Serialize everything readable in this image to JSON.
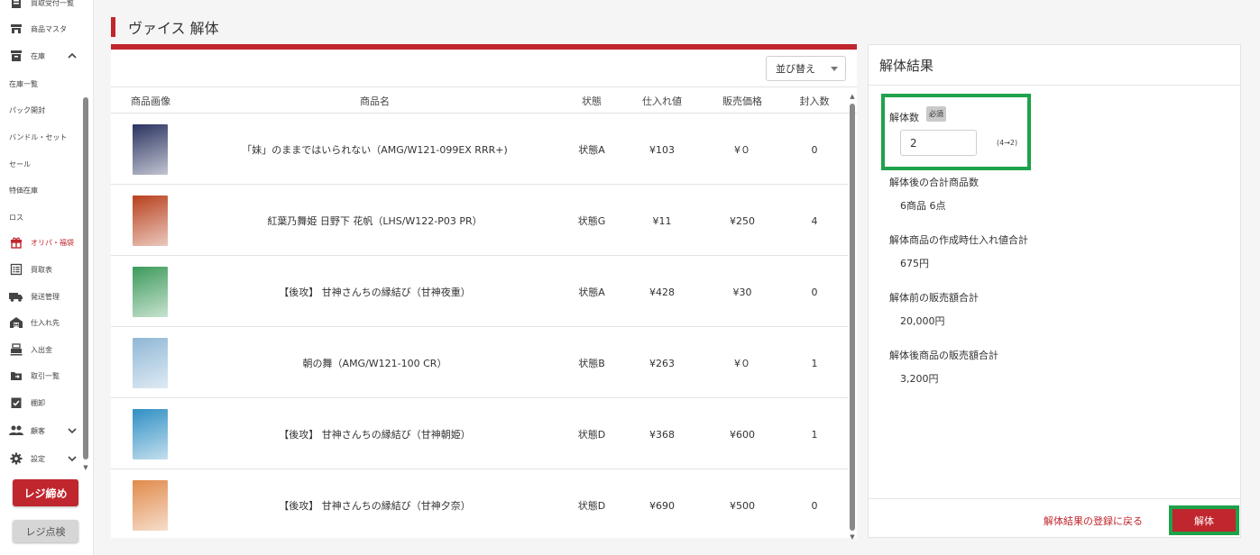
{
  "sidebar": {
    "items": [
      {
        "label": "買取受付一覧",
        "icon": "receipt-icon"
      },
      {
        "label": "商品マスタ",
        "icon": "store-icon"
      },
      {
        "label": "在庫",
        "icon": "inventory-box-icon"
      }
    ],
    "sub_items": [
      "在庫一覧",
      "パック開封",
      "バンドル・セット",
      "セール",
      "特価在庫",
      "ロス"
    ],
    "items2": [
      {
        "label": "オリパ・福袋",
        "icon": "gift-icon"
      },
      {
        "label": "買取表",
        "icon": "list-table-icon"
      },
      {
        "label": "発送管理",
        "icon": "truck-icon"
      },
      {
        "label": "仕入れ先",
        "icon": "warehouse-icon"
      },
      {
        "label": "入出金",
        "icon": "cash-register-icon"
      },
      {
        "label": "取引一覧",
        "icon": "folder-icon"
      },
      {
        "label": "棚卸",
        "icon": "checklist-icon"
      },
      {
        "label": "顧客",
        "icon": "people-icon"
      },
      {
        "label": "設定",
        "icon": "gear-icon"
      }
    ],
    "register_button": "レジ締め",
    "check_button": "レジ点検"
  },
  "page": {
    "title": "ヴァイス 解体"
  },
  "table": {
    "sort_label": "並び替え",
    "headers": [
      "商品画像",
      "商品名",
      "状態",
      "仕入れ値",
      "販売価格",
      "封入数"
    ],
    "rows": [
      {
        "name": "「妹」のままではいられない（AMG/W121-099EX RRR+)",
        "state": "状態A",
        "cost": "¥103",
        "price": "¥０",
        "qty": "0",
        "thumb_color": "#2a3360"
      },
      {
        "name": "紅葉乃舞姫 日野下 花帆（LHS/W122-P03 PR）",
        "state": "状態G",
        "cost": "¥11",
        "price": "¥250",
        "qty": "4",
        "thumb_color": "#b8401c"
      },
      {
        "name": "【後攻】 甘神さんちの縁結び（甘神夜重）",
        "state": "状態A",
        "cost": "¥428",
        "price": "¥30",
        "qty": "0",
        "thumb_color": "#3c9a5a"
      },
      {
        "name": "朝の舞（AMG/W121-100 CR）",
        "state": "状態B",
        "cost": "¥263",
        "price": "¥０",
        "qty": "1",
        "thumb_color": "#8fb7d6"
      },
      {
        "name": "【後攻】 甘神さんちの縁結び（甘神朝姫）",
        "state": "状態D",
        "cost": "¥368",
        "price": "¥600",
        "qty": "1",
        "thumb_color": "#2f8fc4"
      },
      {
        "name": "【後攻】 甘神さんちの縁結び（甘神夕奈）",
        "state": "状態D",
        "cost": "¥690",
        "price": "¥500",
        "qty": "0",
        "thumb_color": "#e08a4a"
      }
    ]
  },
  "result": {
    "title": "解体結果",
    "count_label": "解体数",
    "required_badge": "必須",
    "count_value": "2",
    "count_hint": "(4→2)",
    "total_items_label": "解体後の合計商品数",
    "total_items_value": "6商品 6点",
    "cost_total_label": "解体商品の作成時仕入れ値合計",
    "cost_total_value": "675円",
    "before_sales_label": "解体前の販売額合計",
    "before_sales_value": "20,000円",
    "after_sales_label": "解体後商品の販売額合計",
    "after_sales_value": "3,200円",
    "back_link": "解体結果の登録に戻る",
    "dismantle_button": "解体"
  },
  "colors": {
    "brand": "#c0262d",
    "highlight": "#1ea24a"
  }
}
